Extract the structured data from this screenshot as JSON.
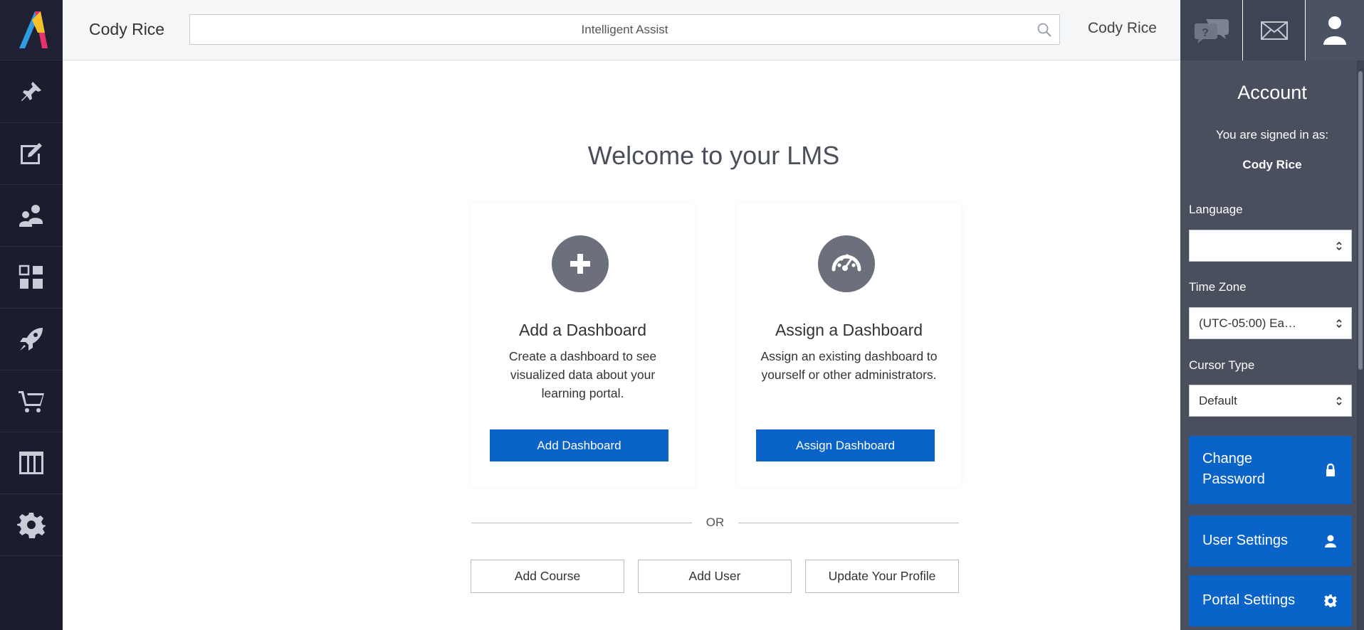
{
  "header": {
    "user_name": "Cody Rice",
    "search_placeholder": "Intelligent Assist",
    "right_user_name": "Cody Rice"
  },
  "sidebar": {
    "items": [
      {
        "icon": "pin-icon"
      },
      {
        "icon": "edit-icon"
      },
      {
        "icon": "users-icon"
      },
      {
        "icon": "dashboard-icon"
      },
      {
        "icon": "rocket-icon"
      },
      {
        "icon": "cart-icon"
      },
      {
        "icon": "columns-icon"
      },
      {
        "icon": "gear-icon"
      }
    ]
  },
  "main": {
    "title": "Welcome to your LMS",
    "cards": [
      {
        "title": "Add a Dashboard",
        "description": "Create a dashboard to see visualized data about your learning portal.",
        "button": "Add Dashboard"
      },
      {
        "title": "Assign a Dashboard",
        "description": "Assign an existing dashboard to yourself or other administrators.",
        "button": "Assign Dashboard"
      }
    ],
    "or_text": "OR",
    "quick_buttons": [
      "Add Course",
      "Add User",
      "Update Your Profile"
    ]
  },
  "panel": {
    "title": "Account",
    "signed_in_label": "You are signed in as:",
    "signed_in_name": "Cody Rice",
    "language_label": "Language",
    "language_value": "",
    "timezone_label": "Time Zone",
    "timezone_value": "(UTC-05:00) Ea…",
    "cursor_label": "Cursor Type",
    "cursor_value": "Default",
    "buttons": {
      "change_password": "Change Password",
      "user_settings": "User Settings",
      "portal_settings": "Portal Settings"
    }
  },
  "colors": {
    "sidebar_bg": "#1b1c2e",
    "primary_blue": "#0a63c9",
    "panel_bg": "#4a4f5e"
  }
}
